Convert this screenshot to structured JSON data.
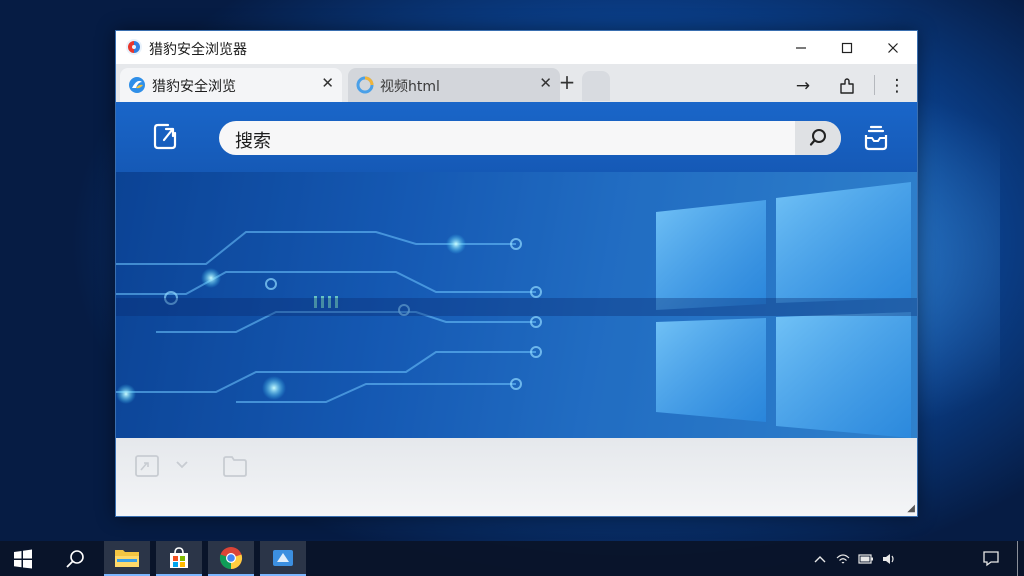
{
  "window": {
    "title": "猎豹安全浏览器",
    "controls": {
      "minimize": "—",
      "maximize": "☐",
      "close": "✕"
    }
  },
  "tabs": [
    {
      "label": "猎豹安全浏览",
      "icon": "cheetah-browser-logo-icon",
      "active": true,
      "close": "✕"
    },
    {
      "label": "视频html",
      "icon": "loading-globe-icon",
      "active": false,
      "close": "✕"
    }
  ],
  "new_tab_label": "+",
  "nav": {
    "forward": "→",
    "extension": "puzzle-icon",
    "menu": "⋮"
  },
  "header": {
    "left_icon": "share-export-icon",
    "search_placeholder": "搜索",
    "search_button_icon": "search-icon",
    "right_icon": "inbox-icon"
  },
  "hero": {
    "image": "circuit-board-windows-wallpaper"
  },
  "bottom": {
    "icons": [
      "image-file-icon",
      "chevron-down-icon",
      "folder-icon"
    ]
  },
  "taskbar": {
    "items": [
      "windows-start-icon",
      "search-icon",
      "file-explorer-icon",
      "store-icon",
      "chrome-icon",
      "cheetah-browser-icon"
    ],
    "tray": [
      "chevron-up-icon",
      "network-icon",
      "battery-icon",
      "volume-icon",
      "notification-icon"
    ]
  },
  "colors": {
    "accent": "#1a66c9",
    "desktop": "#0a3d86"
  }
}
